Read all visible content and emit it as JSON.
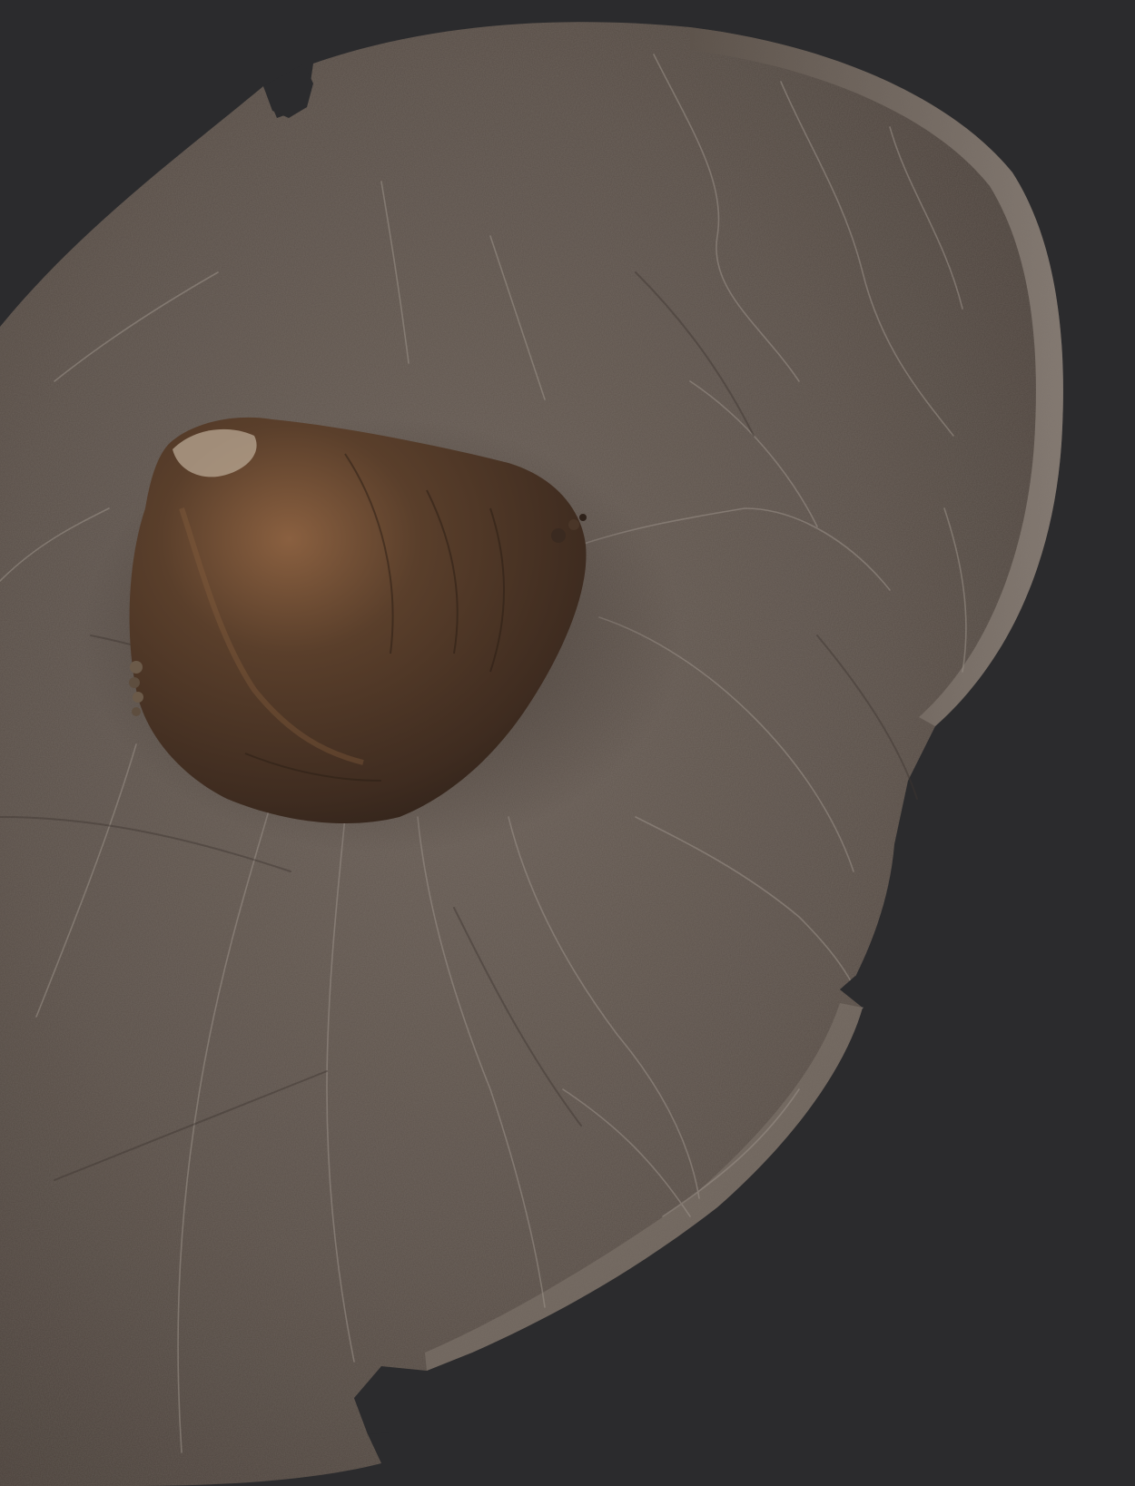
{
  "image": {
    "alt_text": "",
    "colors": {
      "background": "#2b2b2d",
      "hide_base": "#5a5049",
      "hide_light": "#6c625a",
      "hide_dark": "#3e3530",
      "boss_base": "#4a3526",
      "boss_highlight": "#8a6040",
      "crack_line": "#9b9189",
      "rim_edge": "#7a7068"
    }
  }
}
